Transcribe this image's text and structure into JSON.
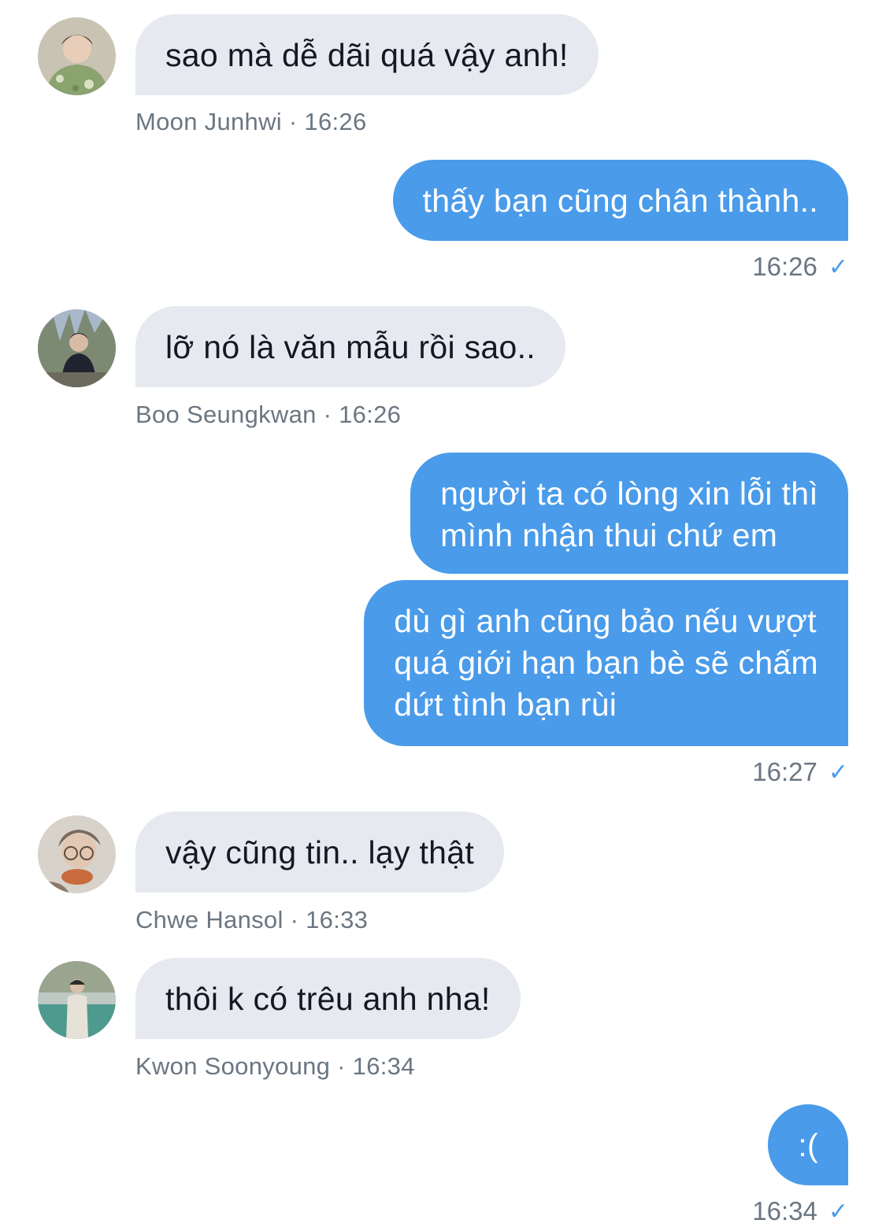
{
  "messages": [
    {
      "direction": "in",
      "sender": "Moon Junhwi",
      "time": "16:26",
      "meta": "Moon Junhwi · 16:26",
      "text": "sao mà dễ dãi quá vậy anh!"
    },
    {
      "direction": "out",
      "time": "16:26",
      "lines": [
        "thấy bạn cũng chân thành.."
      ],
      "check": "✓"
    },
    {
      "direction": "in",
      "sender": "Boo Seungkwan",
      "time": "16:26",
      "meta": "Boo Seungkwan · 16:26",
      "text": "lỡ nó là văn mẫu rồi sao.."
    },
    {
      "direction": "out",
      "time": "16:27",
      "bubbles": [
        {
          "lines": [
            "người ta có lòng xin lỗi thì",
            "mình nhận thui chứ em"
          ]
        },
        {
          "lines": [
            "dù gì anh cũng bảo nếu vượt",
            "quá giới hạn bạn bè sẽ chấm",
            "dứt tình bạn rùi"
          ]
        }
      ],
      "check": "✓"
    },
    {
      "direction": "in",
      "sender": "Chwe Hansol",
      "time": "16:33",
      "meta": "Chwe Hansol · 16:33",
      "text": "vậy cũng tin.. lạy thật"
    },
    {
      "direction": "in",
      "sender": "Kwon Soonyoung",
      "time": "16:34",
      "meta": "Kwon Soonyoung · 16:34",
      "text": "thôi k có trêu anh nha!"
    },
    {
      "direction": "out",
      "time": "16:34",
      "lines": [
        ":("
      ],
      "check": "✓"
    }
  ],
  "colors": {
    "incoming_bubble": "#e6e9ef",
    "outgoing_bubble": "#4a9bea",
    "meta_text": "#6b7681",
    "read_check": "#4a9bea"
  },
  "icons": {
    "read_receipt": "checkmark-icon",
    "avatar": "avatar-photo"
  }
}
